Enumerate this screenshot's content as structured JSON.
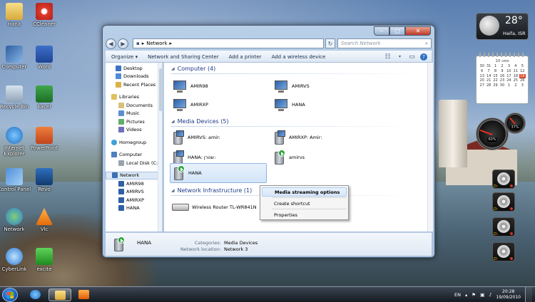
{
  "desktop": {
    "icons": [
      {
        "label": "Hana"
      },
      {
        "label": "CCleaner"
      },
      {
        "label": "Computer"
      },
      {
        "label": "Word"
      },
      {
        "label": "Recycle Bin"
      },
      {
        "label": "Excel"
      },
      {
        "label": "Internet Explorer"
      },
      {
        "label": "PowerPoint"
      },
      {
        "label": "Control Panel"
      },
      {
        "label": "Revo"
      },
      {
        "label": "Network"
      },
      {
        "label": "Vlc"
      },
      {
        "label": "CyberLink"
      },
      {
        "label": "excite"
      }
    ]
  },
  "window": {
    "address": {
      "segment": "Network",
      "arrow": "▸"
    },
    "search_placeholder": "Search Network",
    "toolbar": {
      "organize": "Organize ▾",
      "network_sharing": "Network and Sharing Center",
      "add_printer": "Add a printer",
      "add_wireless": "Add a wireless device"
    },
    "nav": {
      "favorites": [
        "Desktop",
        "Downloads",
        "Recent Places"
      ],
      "libraries": "Libraries",
      "library_items": [
        "Documents",
        "Music",
        "Pictures",
        "Videos"
      ],
      "homegroup": "Homegroup",
      "computer": "Computer",
      "computer_items": [
        "Local Disk (C:)"
      ],
      "network": "Network",
      "network_items": [
        "AMIR98",
        "AMIRVS",
        "AMIRXP",
        "HANA"
      ]
    },
    "groups": {
      "computer": "Computer (4)",
      "media": "Media Devices (5)",
      "infra": "Network Infrastructure (1)"
    },
    "computers": [
      "AMIR98",
      "AMIRVS",
      "AMIRXP",
      "HANA"
    ],
    "media_devices": [
      "AMIRVS: amir:",
      "AMIRXP: Amir:",
      "HANA: שטרן:",
      "amirvs",
      "HANA"
    ],
    "infrastructure": [
      "Wireless Router TL-WR841N"
    ],
    "details": {
      "name": "HANA",
      "cat_key": "Categories:",
      "cat_val": "Media Devices",
      "loc_key": "Network location:",
      "loc_val": "Network  3"
    }
  },
  "context_menu": {
    "items": [
      "Media streaming options",
      "Create shortcut",
      "Properties"
    ]
  },
  "gadgets": {
    "weather": {
      "temp": "28°",
      "city": "Haifa, ISR"
    },
    "calendar": {
      "month": "10 ספט",
      "days": [
        "30",
        "31",
        "1",
        "2",
        "3",
        "4",
        "5",
        "6",
        "7",
        "8",
        "9",
        "10",
        "11",
        "12",
        "13",
        "14",
        "15",
        "16",
        "17",
        "18",
        "19",
        "20",
        "21",
        "22",
        "23",
        "24",
        "25",
        "26",
        "27",
        "28",
        "29",
        "30",
        "1",
        "2",
        "3"
      ],
      "today": "19"
    },
    "cpu": {
      "left": "60%",
      "right": "37%"
    },
    "drives": [
      {
        "label": "D:"
      },
      {
        "label": "D:"
      },
      {
        "label": "D:"
      },
      {
        "label": "D:"
      }
    ]
  },
  "taskbar": {
    "lang": "EN",
    "time": "20:28",
    "date": "19/09/2010"
  }
}
